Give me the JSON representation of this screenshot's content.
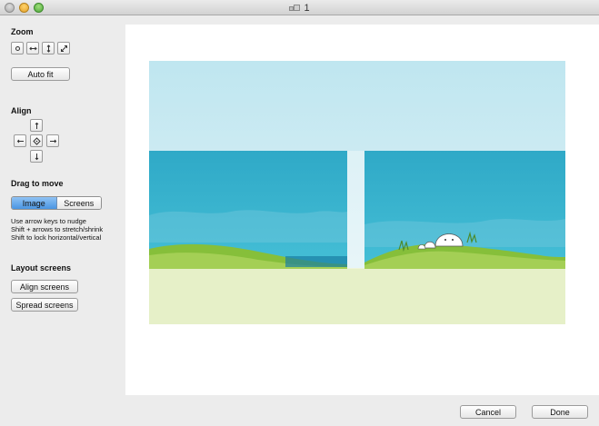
{
  "window": {
    "title": "1"
  },
  "sidebar": {
    "zoom": {
      "title": "Zoom",
      "buttons": [
        "zoom-actual-icon",
        "fit-width-icon",
        "fit-height-icon",
        "fit-diagonal-icon"
      ],
      "auto_fit_label": "Auto fit"
    },
    "align": {
      "title": "Align",
      "buttons": [
        "arrow-up-icon",
        "arrow-left-icon",
        "center-icon",
        "arrow-right-icon",
        "arrow-down-icon"
      ]
    },
    "drag": {
      "title": "Drag to move",
      "segments": [
        "Image",
        "Screens"
      ],
      "selected": "Image",
      "hints": [
        "Use arrow keys to nudge",
        "Shift + arrows to stretch/shrink",
        "Shift to lock horizontal/vertical"
      ]
    },
    "layout": {
      "title": "Layout screens",
      "align_label": "Align screens",
      "spread_label": "Spread screens"
    }
  },
  "footer": {
    "cancel_label": "Cancel",
    "done_label": "Done"
  },
  "colors": {
    "sky": "#b9e3ee",
    "sea": "#35b4cf",
    "grass": "#86bf3a",
    "ground": "#e6f0c8",
    "accent": "#4a95e2"
  }
}
